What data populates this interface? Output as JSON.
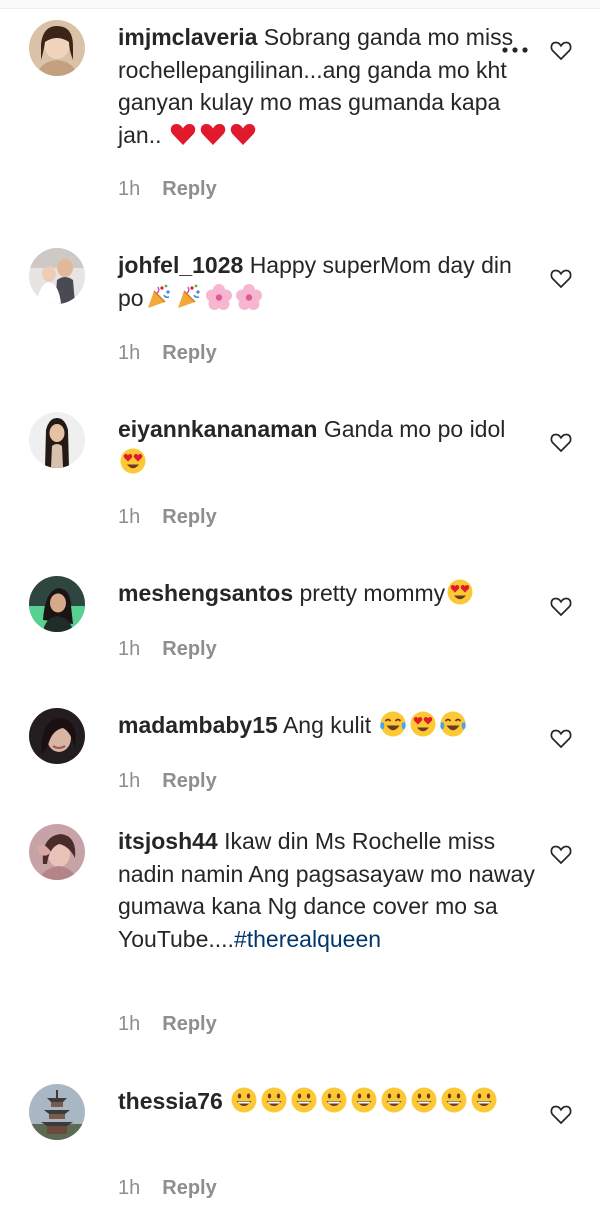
{
  "comments": [
    {
      "username": "imjmclaveria",
      "text": "Sobrang ganda mo miss rochellepangilinan...ang ganda mo kht ganyan kulay mo mas gumanda kapa jan..",
      "time": "1h",
      "reply_label": "Reply",
      "emojis": [
        "red-heart",
        "red-heart",
        "red-heart"
      ]
    },
    {
      "username": "johfel_1028",
      "text": "Happy superMom day din po",
      "time": "1h",
      "reply_label": "Reply",
      "emojis": [
        "party-popper",
        "party-popper",
        "cherry-blossom",
        "cherry-blossom"
      ]
    },
    {
      "username": "eiyannkananaman",
      "text": "Ganda mo po idol",
      "time": "1h",
      "reply_label": "Reply",
      "emojis": [
        "heart-eyes"
      ]
    },
    {
      "username": "meshengsantos",
      "text": "pretty mommy",
      "time": "1h",
      "reply_label": "Reply",
      "emojis": [
        "heart-eyes"
      ]
    },
    {
      "username": "madambaby15",
      "text": "Ang kulit",
      "time": "1h",
      "reply_label": "Reply",
      "emojis": [
        "tears-of-joy",
        "heart-eyes",
        "tears-of-joy"
      ]
    },
    {
      "username": "itsjosh44",
      "text": "Ikaw din Ms Rochelle miss nadin namin Ang pagsasayaw mo naway gumawa kana Ng dance cover mo sa YouTube....",
      "hashtag": "#therealqueen",
      "time": "1h",
      "reply_label": "Reply",
      "emojis": []
    },
    {
      "username": "thessia76",
      "text": "",
      "time": "1h",
      "reply_label": "Reply",
      "emojis": [
        "grinning",
        "grinning",
        "grinning",
        "grinning",
        "grinning",
        "grinning",
        "grinning",
        "grinning",
        "grinning"
      ]
    }
  ],
  "icons": {
    "like": "heart-outline-icon",
    "more": "more-options-icon"
  },
  "colors": {
    "text": "#262626",
    "meta": "#8e8e8e",
    "hashtag": "#00376b"
  }
}
